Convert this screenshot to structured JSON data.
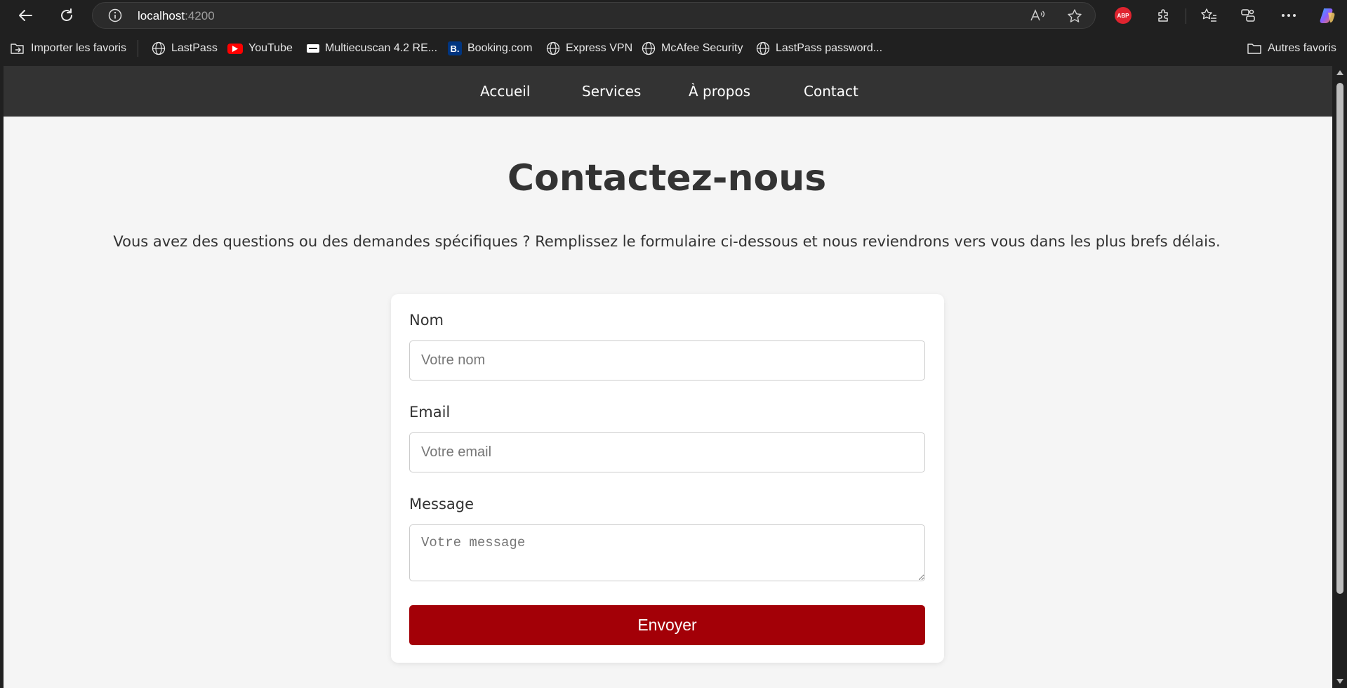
{
  "browser": {
    "url_host": "localhost",
    "url_port": ":4200",
    "abp_label": "ABP",
    "bookmarks": [
      {
        "label": "Importer les favoris",
        "icon": "import-favorites-icon"
      },
      {
        "label": "LastPass",
        "icon": "globe-icon"
      },
      {
        "label": "YouTube",
        "icon": "youtube-icon"
      },
      {
        "label": "Multiecuscan 4.2 RE...",
        "icon": "multiecuscan-icon"
      },
      {
        "label": "Booking.com",
        "icon": "booking-icon"
      },
      {
        "label": "Express VPN",
        "icon": "globe-icon"
      },
      {
        "label": "McAfee Security",
        "icon": "globe-icon"
      },
      {
        "label": "LastPass password...",
        "icon": "globe-icon"
      }
    ],
    "other_favorites": "Autres favoris",
    "booking_letter": "B."
  },
  "site_nav": {
    "links": [
      "Accueil",
      "Services",
      "À propos",
      "Contact"
    ]
  },
  "page": {
    "title": "Contactez-nous",
    "intro": "Vous avez des questions ou des demandes spécifiques ? Remplissez le formulaire ci-dessous et nous reviendrons vers vous dans les plus brefs délais."
  },
  "form": {
    "name_label": "Nom",
    "name_placeholder": "Votre nom",
    "email_label": "Email",
    "email_placeholder": "Votre email",
    "message_label": "Message",
    "message_placeholder": "Votre message",
    "submit_label": "Envoyer"
  },
  "colors": {
    "nav_bg": "#333333",
    "page_bg": "#f5f5f5",
    "button_bg": "#a30007",
    "text": "#333333"
  }
}
